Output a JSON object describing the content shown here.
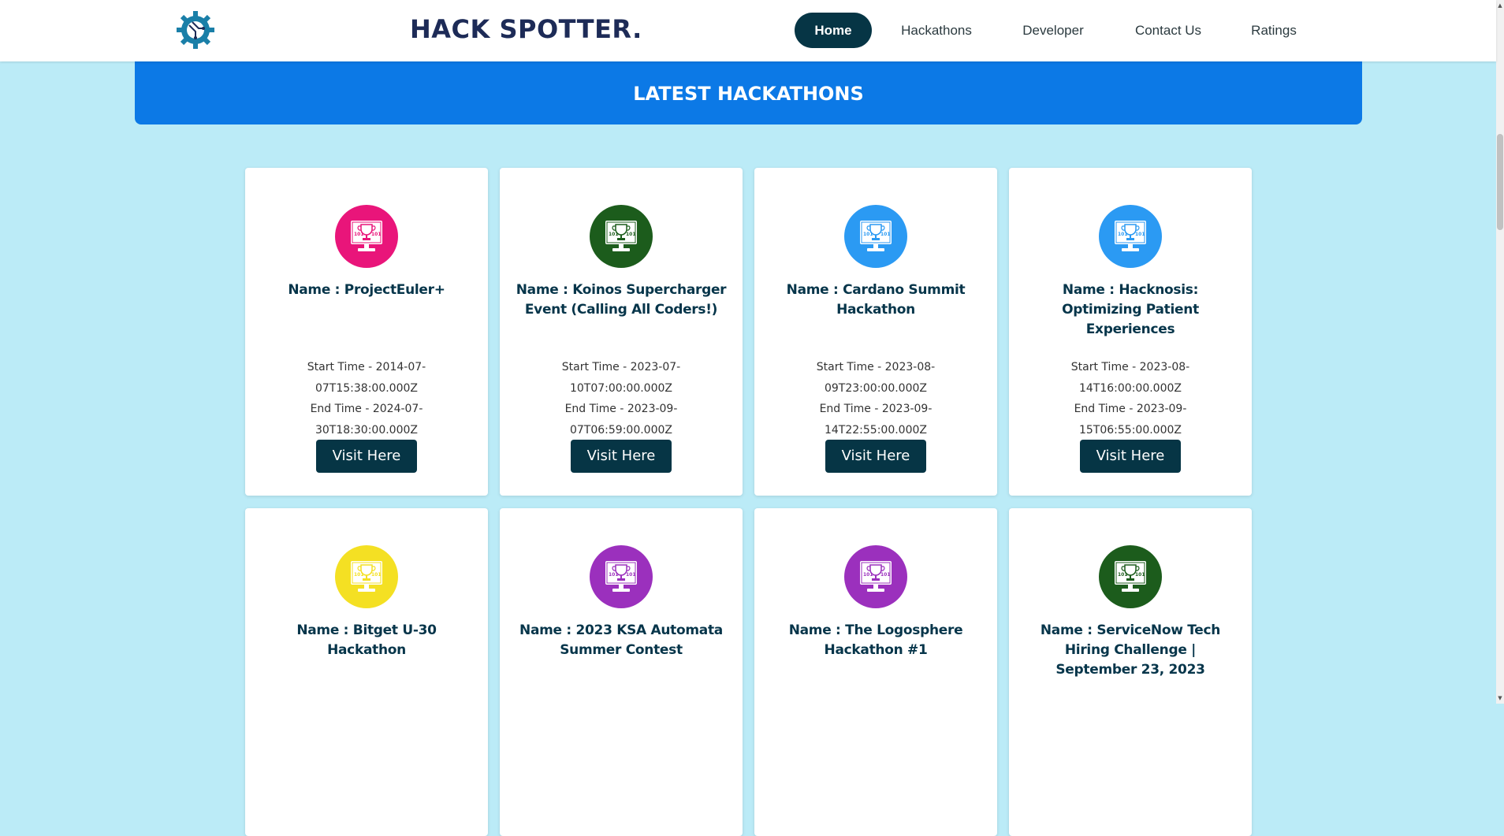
{
  "nav": {
    "brand": "HACK SPOTTER.",
    "items": [
      "Home",
      "Hackathons",
      "Developer",
      "Contact Us",
      "Ratings"
    ],
    "active": "Home"
  },
  "banner": {
    "title": "LATEST HACKATHONS"
  },
  "cards": [
    {
      "name": "Name : ProjectEuler+",
      "start": "Start Time - 2014-07-07T15:38:00.000Z",
      "end": "End Time - 2024-07-30T18:30:00.000Z",
      "button": "Visit Here",
      "color": "#e9157a"
    },
    {
      "name": "Name : Koinos Supercharger Event (Calling All Coders!)",
      "start": "Start Time - 2023-07-10T07:00:00.000Z",
      "end": "End Time - 2023-09-07T06:59:00.000Z",
      "button": "Visit Here",
      "color": "#1c5c1c"
    },
    {
      "name": "Name : Cardano Summit Hackathon",
      "start": "Start Time - 2023-08-09T23:00:00.000Z",
      "end": "End Time - 2023-09-14T22:55:00.000Z",
      "button": "Visit Here",
      "color": "#2b9af3"
    },
    {
      "name": "Name : Hacknosis: Optimizing Patient Experiences",
      "start": "Start Time - 2023-08-14T16:00:00.000Z",
      "end": "End Time - 2023-09-15T06:55:00.000Z",
      "button": "Visit Here",
      "color": "#2b9af3"
    },
    {
      "name": "Name : Bitget U-30 Hackathon",
      "start": "",
      "end": "",
      "button": "",
      "color": "#f4e023"
    },
    {
      "name": "Name : 2023 KSA Automata Summer Contest",
      "start": "",
      "end": "",
      "button": "",
      "color": "#9b30bd"
    },
    {
      "name": "Name : The Logosphere Hackathon #1",
      "start": "",
      "end": "",
      "button": "",
      "color": "#9b30bd"
    },
    {
      "name": "Name : ServiceNow Tech Hiring Challenge | September 23, 2023",
      "start": "",
      "end": "",
      "button": "",
      "color": "#1c5c1c"
    }
  ],
  "icons": {
    "logo": "gear-circuit-logo",
    "card": "trophy-monitor-icon"
  },
  "colors": {
    "navActive": "#063545",
    "banner": "#0c79e6",
    "background": "#bbebf7"
  }
}
